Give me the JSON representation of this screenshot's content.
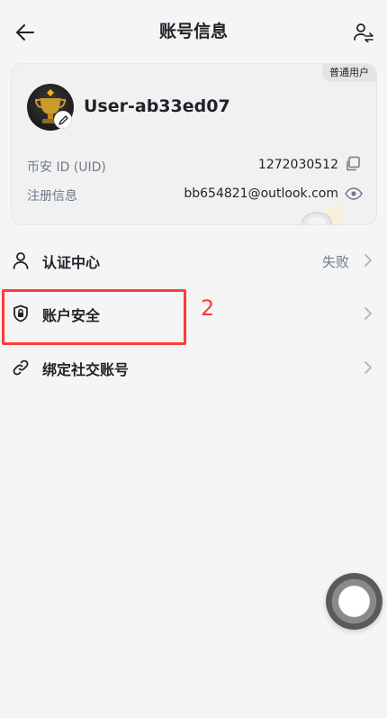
{
  "header": {
    "title": "账号信息"
  },
  "profile": {
    "badge": "普通用户",
    "username": "User-ab33ed07",
    "uid_label": "币安 ID (UID)",
    "uid_value": "1272030512",
    "reg_label": "注册信息",
    "reg_value": "bb654821@outlook.com"
  },
  "menu": {
    "items": [
      {
        "label": "认证中心",
        "status": "失败",
        "icon": "person-icon"
      },
      {
        "label": "账户安全",
        "status": "",
        "icon": "shield-lock-icon"
      },
      {
        "label": "绑定社交账号",
        "status": "",
        "icon": "link-icon"
      }
    ]
  },
  "annotation": {
    "step": "2",
    "color": "#ff3b3b"
  }
}
